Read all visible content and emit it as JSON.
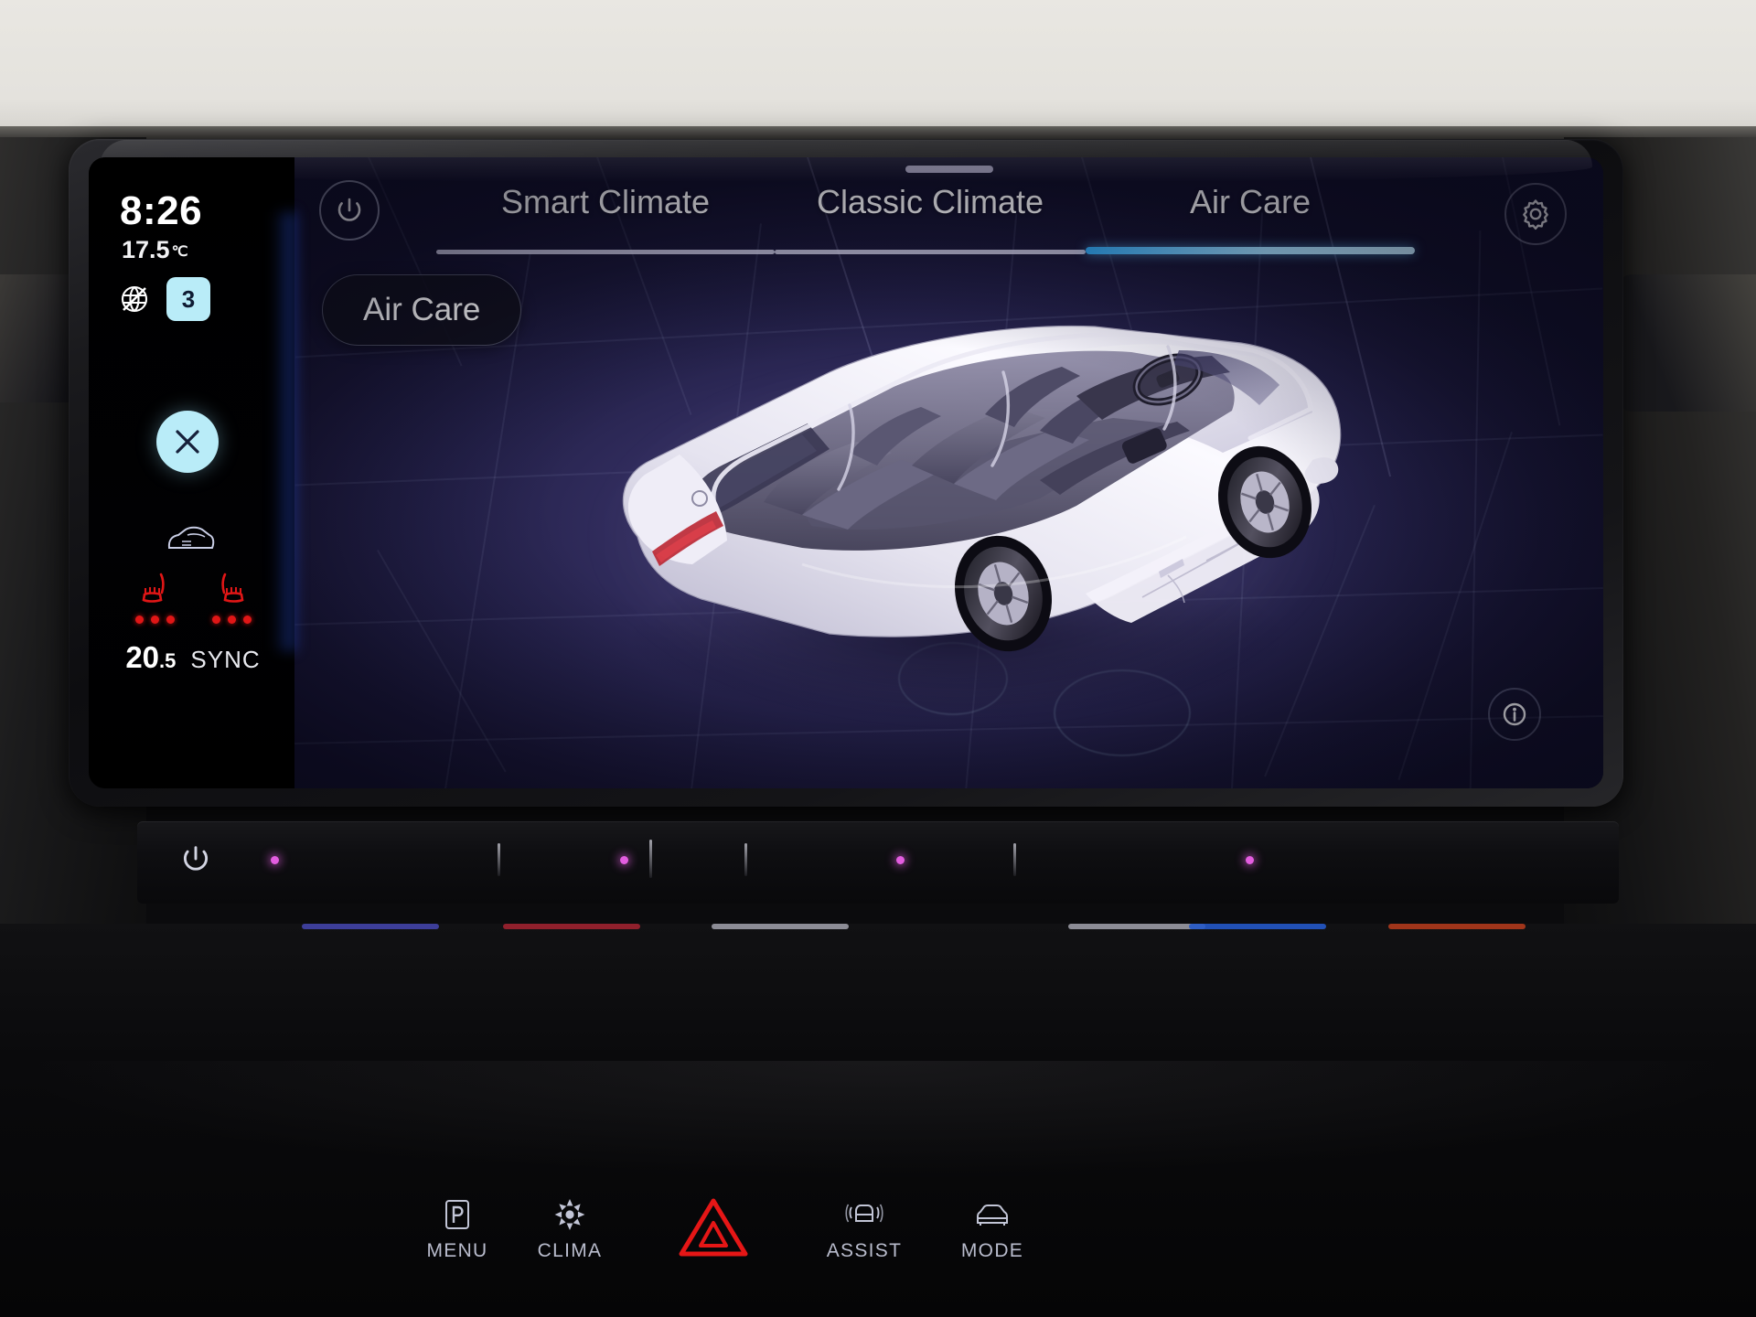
{
  "status_rail": {
    "clock": "8:26",
    "outside_temp": "17.5",
    "outside_temp_unit": "℃",
    "recirculation_icon": "recirculation-off-icon",
    "fan_speed": "3",
    "close_icon": "close-x-icon",
    "rear_defrost_icon": "rear-window-defrost-icon",
    "seat_left_icon": "seat-heating-left-icon",
    "seat_right_icon": "seat-heating-right-icon",
    "seat_left_level": 3,
    "seat_right_level": 3,
    "cabin_temp_int": "20",
    "cabin_temp_dec": ".5",
    "sync_label": "SYNC"
  },
  "panel": {
    "drag_handle": "drag-handle",
    "power_icon": "power-icon",
    "settings_icon": "gear-icon",
    "info_icon": "info-icon",
    "mode_pill_label": "Air Care",
    "tabs": [
      {
        "label": "Smart Climate",
        "active": false
      },
      {
        "label": "Classic Climate",
        "active": false
      },
      {
        "label": "Air Care",
        "active": true
      }
    ],
    "vehicle_graphic": "vehicle-3d-cutaway-icon"
  },
  "slider_strip": {
    "power_icon": "power-icon",
    "indicator_dots": 4,
    "indicator_bars": [
      "#4244a8",
      "#9e2230",
      "#9a9aa4",
      "#9a9aa4",
      "#2358c8",
      "#b03a1c"
    ]
  },
  "hard_keys": [
    {
      "label": "MENU",
      "icon": "park-p-icon"
    },
    {
      "label": "CLIMA",
      "icon": "fan-icon"
    },
    {
      "label": "",
      "icon": "hazard-triangle-icon"
    },
    {
      "label": "ASSIST",
      "icon": "car-assist-icon"
    },
    {
      "label": "MODE",
      "icon": "car-front-icon"
    }
  ],
  "colors": {
    "accent_cyan": "#b9ecf8",
    "tab_active_underline": "#5fb8ef",
    "seat_heat_red": "#e01616",
    "hazard_red": "#e51616",
    "panel_blue": "#332e60"
  }
}
